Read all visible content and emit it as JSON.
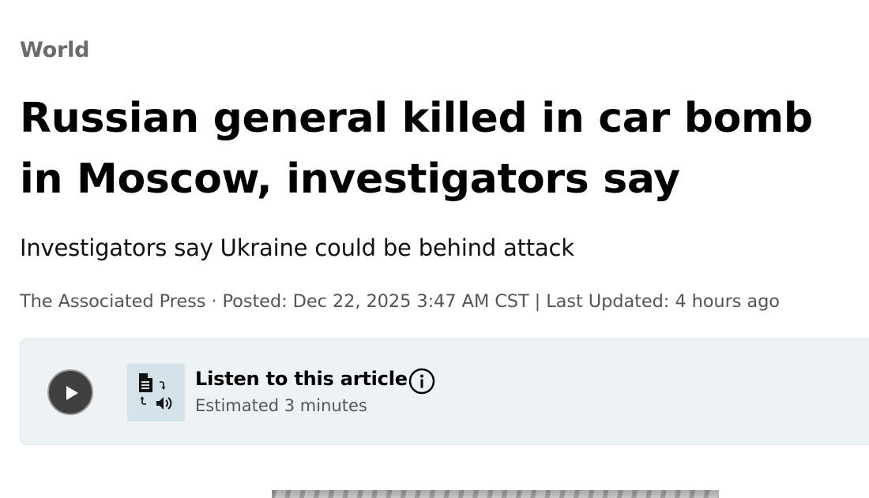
{
  "article": {
    "section": "World",
    "headline": "Russian general killed in car bomb in Moscow, investigators say",
    "deck": "Investigators say Ukraine could be behind attack",
    "byline": "The Associated Press · Posted: Dec 22, 2025 3:47 AM CST | Last Updated: 4 hours ago"
  },
  "audio_player": {
    "title": "Listen to this article",
    "duration": "Estimated 3 minutes",
    "play_icon": "play-icon",
    "thumbnail_icon": "text-to-speech-icon",
    "info_icon": "info-icon",
    "colors": {
      "background": "#edf2f5",
      "play_button": "#404040",
      "thumbnail_bg": "#d4e3ea"
    }
  },
  "colors": {
    "section": "#6b6b6b",
    "headline": "#000000",
    "byline": "#555555"
  }
}
